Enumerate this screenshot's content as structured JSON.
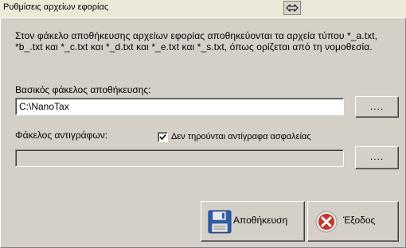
{
  "window": {
    "title": "Ρυθμίσεις αρχείων εφορίας"
  },
  "description": "Στον φάκελο αποθήκευσης αρχείων εφορίας αποθηκεύονται τα αρχεία τύπου *_a.txt, *b_.txt και *_c.txt και *_d.txt και *_e.txt και *_s.txt, όπως ορίζεται από τη νομοθεσία.",
  "main_folder": {
    "label": "Βασικός φάκελος αποθήκευσης:",
    "value": "C:\\NanoTax",
    "browse_label": "...."
  },
  "copies_folder": {
    "label": "Φάκελος αντιγράφων:",
    "value": "",
    "browse_label": "...."
  },
  "no_backup_checkbox": {
    "label": "Δεν τηρούνται αντίγραφα ασφαλείας",
    "checked": true
  },
  "buttons": {
    "save_label": "Αποθήκευση",
    "exit_label": "Έξοδος"
  },
  "icons": {
    "restore": "restore-arrows-icon",
    "save": "floppy-disk-icon",
    "exit": "exit-x-icon"
  },
  "colors": {
    "face": "#d4d0c8",
    "save_icon": "#2a5db0",
    "exit_icon": "#c0392b"
  }
}
